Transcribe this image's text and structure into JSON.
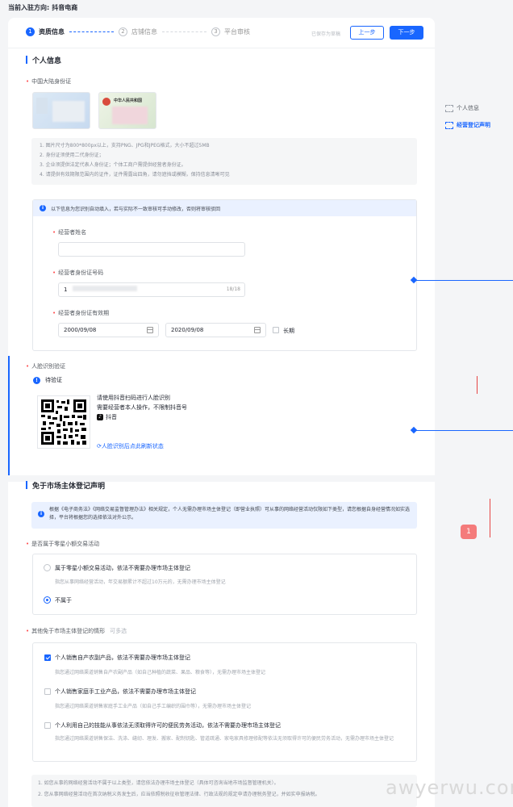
{
  "header": {
    "direction_label": "当前入驻方向:",
    "direction_value": "抖音电商"
  },
  "stepper": {
    "steps": [
      {
        "num": "1",
        "label": "资质信息"
      },
      {
        "num": "2",
        "label": "店铺信息"
      },
      {
        "num": "3",
        "label": "平台审核"
      }
    ],
    "autosave": "已保存为草稿",
    "prev": "上一步",
    "next": "下一步"
  },
  "personal": {
    "title": "个人信息",
    "id_label": "中国大陆身份证",
    "id_back_text": "中华人民共和国",
    "tips": [
      "1. 图片尺寸为800*800px以上，支持PNG、JPG和JPEG格式，大小不超过5MB",
      "2. 身份证须使用二代身份证；",
      "3. 企业须提供法定代表人身份证；个体工商户需提供经营者身份证。",
      "4. 请提供有效期限范围内的证件，证件需露出四角，请勿遮挡或模糊，保持信息清晰可见"
    ],
    "ocr_notice": "以下信息为您识别自动填入，若与实际不一致审核可手动修改，否则将审核驳回",
    "name_label": "经营者姓名",
    "name_value": "",
    "idno_label": "经营者身份证号码",
    "idno_value": "1",
    "idno_counter": "18/18",
    "validity_label": "经营者身份证有效期",
    "validity_start": "2000/09/08",
    "validity_end": "2020/09/08",
    "longterm_label": "长期"
  },
  "face": {
    "title": "人脸识别验证",
    "status": "待验证",
    "line1": "请使用抖音扫码进行人脸识别",
    "line2": "需要经营者本人操作，不限制抖音号",
    "app_name": "抖音",
    "refresh": "人脸识别后点此刷新状态"
  },
  "exempt": {
    "title": "免于市场主体登记声明",
    "notice": "根据《电子商务法》《网络交易监督管理办法》相关规定，个人无需办理市场主体登记（即营业执照）可从事的网络经营活动仅限如下类型，请您根据自身经营情况如实选择，平台将根据您的选择依法对外公示。",
    "q1_label": "是否属于零星小额交易活动",
    "q1_opt1_title": "属于零星小额交易活动，依法不需要办理市场主体登记",
    "q1_opt1_desc": "指您从事网络经营活动，年交易额累计不超过10万元的，无需办理市场主体登记",
    "q1_opt2_title": "不属于",
    "q2_label": "其他免于市场主体登记的情形",
    "q2_hint": "可多选",
    "q2_opts": [
      {
        "title": "个人销售自产农副产品，依法不需要办理市场主体登记",
        "desc": "指您通过网络渠道销售自产农副产品（如自己种植的蔬菜、果品、粮食等），无需办理市场主体登记",
        "checked": true
      },
      {
        "title": "个人销售家庭手工业产品，依法不需要办理市场主体登记",
        "desc": "指您通过网络渠道销售家庭手工业产品（如自己手工编织的围巾等），无需办理市场主体登记",
        "checked": false
      },
      {
        "title": "个人利用自己的技能从事依法无须取得许可的便民劳务活动，依法不需要办理市场主体登记",
        "desc": "指您通过网络渠道销售保洁、洗涤、缝纫、理发、搬家、配制钥匙、管道疏通、家电家具修理修配等依法无须取得许可的便民劳务活动，无需办理市场主体登记",
        "checked": false
      }
    ],
    "footer": [
      "1. 如您从事的网络经营活动不属于以上类型，请您依法办理市场主体登记（具体可咨询当地市场监督管理机关）。",
      "2. 您从事网络经营活动在首次纳税义务发生后，应当依照税收征收管理法律、行政法规的规定申请办理税务登记，并如实申报纳税。"
    ]
  },
  "rightnav": {
    "item1": "个人信息",
    "item2": "经营登记声明"
  },
  "badge": "1",
  "watermark": "awyerwu.com"
}
